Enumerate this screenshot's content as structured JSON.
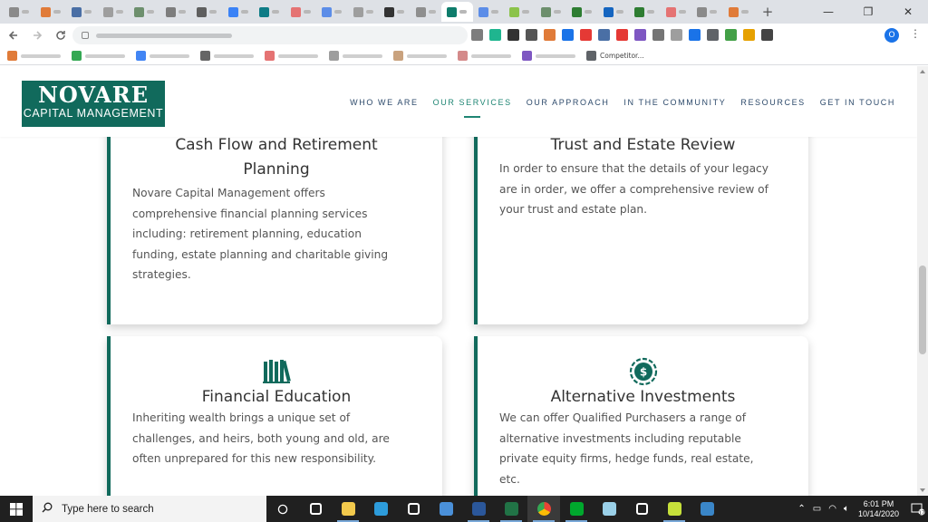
{
  "browser": {
    "tab_count": 24,
    "active_tab_index": 14,
    "new_tab_label": "+",
    "window_controls": [
      "—",
      "❐",
      "✕"
    ],
    "bookmarks": [
      {
        "label": "",
        "color": "#e07b39"
      },
      {
        "label": "",
        "color": "#34a853"
      },
      {
        "label": "",
        "color": "#4285f4"
      },
      {
        "label": "",
        "color": "#666666"
      },
      {
        "label": "",
        "color": "#e57373"
      },
      {
        "label": "",
        "color": "#9e9e9e"
      },
      {
        "label": "",
        "color": "#c9a27e"
      },
      {
        "label": "",
        "color": "#d48a8a"
      },
      {
        "label": "",
        "color": "#7e57c2"
      },
      {
        "label": "Competitor...",
        "color": "#5f6368"
      }
    ],
    "profile_initial": "O",
    "menu_icon": "⋮"
  },
  "site": {
    "logo": {
      "main": "NOVARE",
      "sub": "CAPITAL MANAGEMENT"
    },
    "nav": [
      {
        "label": "WHO WE ARE",
        "active": false
      },
      {
        "label": "OUR SERVICES",
        "active": true
      },
      {
        "label": "OUR APPROACH",
        "active": false
      },
      {
        "label": "IN THE COMMUNITY",
        "active": false
      },
      {
        "label": "RESOURCES",
        "active": false
      },
      {
        "label": "GET IN TOUCH",
        "active": false
      }
    ],
    "cards": [
      {
        "title_line1": "Cash Flow and Retirement",
        "title_line2": "Planning",
        "body": [
          "Novare Capital Management offers",
          "comprehensive financial planning services",
          "including: retirement planning, education",
          "funding, estate planning and charitable giving",
          "strategies."
        ],
        "icon": "none"
      },
      {
        "title_line1": "Trust and Estate Review",
        "body": [
          "In order to ensure that the details of your legacy",
          "are in order, we offer a comprehensive review of",
          "your trust and estate plan."
        ],
        "icon": "none"
      },
      {
        "title_line1": "Financial Education",
        "body": [
          "Inheriting wealth brings a unique set of",
          "challenges, and heirs, both young and old, are",
          "often unprepared for this new responsibility."
        ],
        "icon": "books-icon"
      },
      {
        "title_line1": "Alternative Investments",
        "body": [
          "We can offer Qualified Purchasers a range of",
          "alternative investments including reputable",
          "private equity firms, hedge funds, real estate,",
          "etc."
        ],
        "icon": "dollar-coin-icon"
      }
    ],
    "colors": {
      "brand": "#116a5c",
      "accent": "#1e8573",
      "nav_text": "#2d4a6b"
    }
  },
  "taskbar": {
    "search_placeholder": "Type here to search",
    "apps": [
      "task-view-icon",
      "file-explorer-icon",
      "edge-icon",
      "store-icon",
      "mail-icon",
      "word-icon",
      "excel-icon",
      "chrome-icon",
      "evernote-icon",
      "notes-icon",
      "settings-icon",
      "snipping-icon",
      "photos-icon"
    ],
    "time": "6:01 PM",
    "date": "10/14/2020",
    "notification_count": "17"
  }
}
